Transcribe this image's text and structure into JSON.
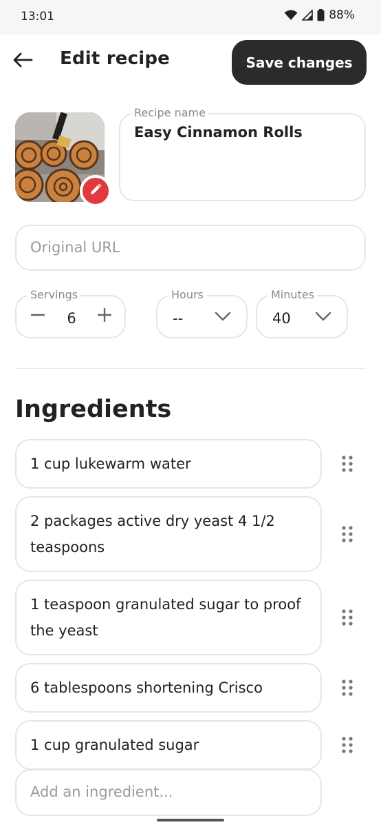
{
  "status_bar": {
    "time": "13:01",
    "battery": "88%"
  },
  "header": {
    "title": "Edit recipe",
    "save_label": "Save changes"
  },
  "recipe": {
    "name_label": "Recipe name",
    "name_value": "Easy Cinnamon Rolls",
    "url_placeholder": "Original URL",
    "servings_label": "Servings",
    "servings_value": "6",
    "hours_label": "Hours",
    "hours_value": "--",
    "minutes_label": "Minutes",
    "minutes_value": "40"
  },
  "ingredients": {
    "title": "Ingredients",
    "items": [
      "1 cup lukewarm water",
      "2 packages active dry yeast 4 1/2 teaspoons",
      "1 teaspoon granulated sugar to proof the yeast",
      "6 tablespoons shortening Crisco",
      "1 cup granulated sugar"
    ],
    "add_placeholder": "Add an ingredient..."
  },
  "icons": {
    "back": "arrow-left-icon",
    "edit_photo": "pencil-icon",
    "decrement": "minus-icon",
    "increment": "plus-icon",
    "dropdown": "chevron-down-icon",
    "drag": "drag-handle-icon"
  },
  "colors": {
    "primary_button": "#2b2b2b",
    "accent": "#e0393e",
    "border": "#e6e6e6"
  }
}
